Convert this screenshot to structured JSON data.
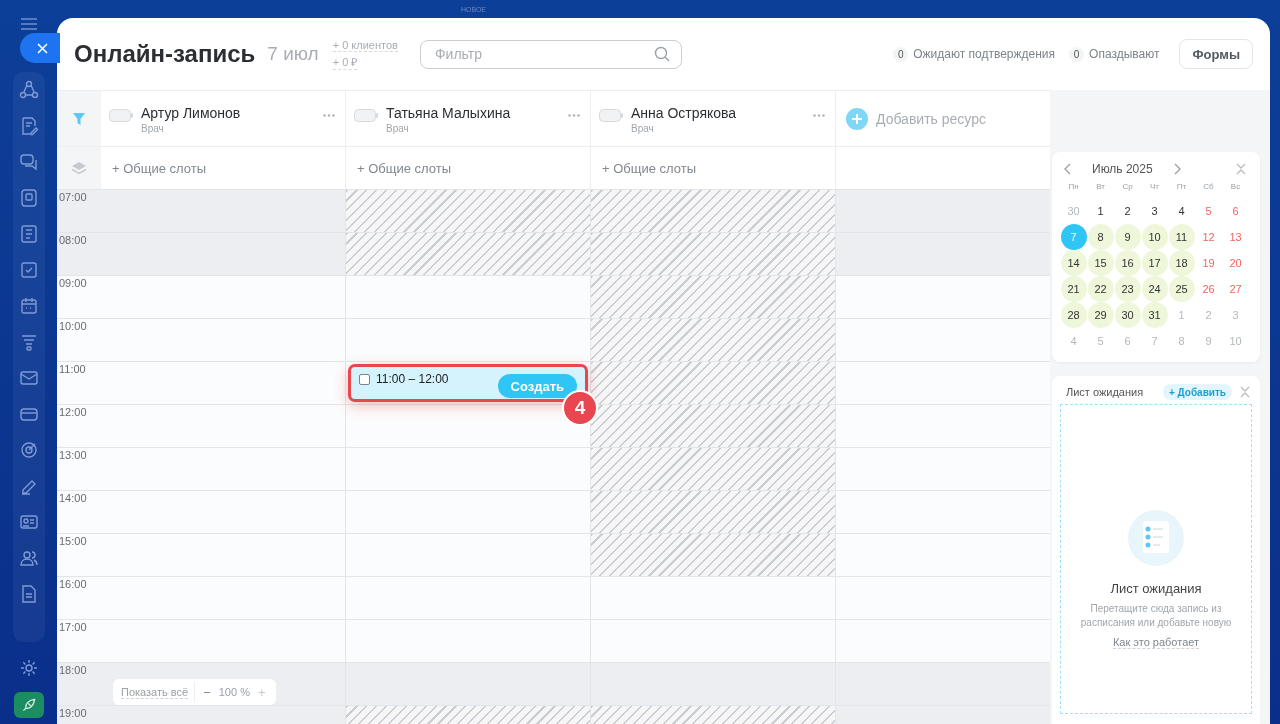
{
  "top_strip": {
    "label": "НОВОЕ"
  },
  "header": {
    "title": "Онлайн-запись",
    "date": "7 июл",
    "stats": [
      "+ 0 клиентов",
      "+ 0 ₽"
    ],
    "filter": {
      "placeholder": "Фильтр"
    },
    "counters": [
      {
        "count": "0",
        "label": "Ожидают подтверждения"
      },
      {
        "count": "0",
        "label": "Опаздывают"
      }
    ],
    "forms_button": "Формы"
  },
  "resources": [
    {
      "name": "Артур Лимонов",
      "role": "Врач",
      "slots": "+ Общие слоты",
      "cells": [
        {
          "blocked": false
        },
        {
          "blocked": false
        },
        {
          "blocked": false
        },
        {
          "blocked": false
        },
        {
          "blocked": false
        },
        {
          "blocked": false
        },
        {
          "blocked": false
        },
        {
          "blocked": false
        },
        {
          "blocked": false
        },
        {
          "blocked": false
        },
        {
          "blocked": false
        },
        {
          "blocked": false
        },
        {
          "blocked": false
        }
      ]
    },
    {
      "name": "Татьяна Малыхина",
      "role": "Врач",
      "slots": "+ Общие слоты",
      "cells": [
        {
          "blocked": true
        },
        {
          "blocked": true
        },
        {
          "blocked": false
        },
        {
          "blocked": false
        },
        {
          "blocked": false
        },
        {
          "blocked": false
        },
        {
          "blocked": false
        },
        {
          "blocked": false
        },
        {
          "blocked": false
        },
        {
          "blocked": false
        },
        {
          "blocked": false
        },
        {
          "blocked": false
        },
        {
          "blocked": true
        }
      ]
    },
    {
      "name": "Анна Острякова",
      "role": "Врач",
      "slots": "+ Общие слоты",
      "cells": [
        {
          "blocked": true
        },
        {
          "blocked": true
        },
        {
          "blocked": true
        },
        {
          "blocked": true
        },
        {
          "blocked": true
        },
        {
          "blocked": true
        },
        {
          "blocked": true
        },
        {
          "blocked": true
        },
        {
          "blocked": true
        },
        {
          "blocked": false
        },
        {
          "blocked": false
        },
        {
          "blocked": false
        },
        {
          "blocked": true
        }
      ]
    }
  ],
  "add_resource": "Добавить ресурс",
  "hours": [
    {
      "time": "07:00",
      "off_hours": true
    },
    {
      "time": "08:00",
      "off_hours": true
    },
    {
      "time": "09:00",
      "off_hours": false
    },
    {
      "time": "10:00",
      "off_hours": false
    },
    {
      "time": "11:00",
      "off_hours": false
    },
    {
      "time": "12:00",
      "off_hours": false
    },
    {
      "time": "13:00",
      "off_hours": false
    },
    {
      "time": "14:00",
      "off_hours": false
    },
    {
      "time": "15:00",
      "off_hours": false
    },
    {
      "time": "16:00",
      "off_hours": false
    },
    {
      "time": "17:00",
      "off_hours": false
    },
    {
      "time": "18:00",
      "off_hours": true
    },
    {
      "time": "19:00",
      "off_hours": true
    }
  ],
  "new_slot": {
    "time": "11:00 – 12:00",
    "checked": false,
    "button": "Создать",
    "callout": "4"
  },
  "zoom_bar": {
    "show_all": "Показать всё",
    "minus": "−",
    "value": "100 %",
    "plus": "+"
  },
  "calendar": {
    "title": "Июль 2025",
    "weekdays": [
      "Пн",
      "Вт",
      "Ср",
      "Чт",
      "Пт",
      "Сб",
      "Вс"
    ],
    "weeks": [
      [
        {
          "day": "30",
          "outside": true,
          "weekend": false,
          "available": false,
          "selected": false
        },
        {
          "day": "1",
          "outside": false,
          "weekend": false,
          "available": false,
          "selected": false
        },
        {
          "day": "2",
          "outside": false,
          "weekend": false,
          "available": false,
          "selected": false
        },
        {
          "day": "3",
          "outside": false,
          "weekend": false,
          "available": false,
          "selected": false
        },
        {
          "day": "4",
          "outside": false,
          "weekend": false,
          "available": false,
          "selected": false
        },
        {
          "day": "5",
          "outside": false,
          "weekend": true,
          "available": false,
          "selected": false
        },
        {
          "day": "6",
          "outside": false,
          "weekend": true,
          "available": false,
          "selected": false
        }
      ],
      [
        {
          "day": "7",
          "outside": false,
          "weekend": false,
          "available": true,
          "selected": true
        },
        {
          "day": "8",
          "outside": false,
          "weekend": false,
          "available": true,
          "selected": false
        },
        {
          "day": "9",
          "outside": false,
          "weekend": false,
          "available": true,
          "selected": false
        },
        {
          "day": "10",
          "outside": false,
          "weekend": false,
          "available": true,
          "selected": false
        },
        {
          "day": "11",
          "outside": false,
          "weekend": false,
          "available": true,
          "selected": false
        },
        {
          "day": "12",
          "outside": false,
          "weekend": true,
          "available": false,
          "selected": false
        },
        {
          "day": "13",
          "outside": false,
          "weekend": true,
          "available": false,
          "selected": false
        }
      ],
      [
        {
          "day": "14",
          "outside": false,
          "weekend": false,
          "available": true,
          "selected": false
        },
        {
          "day": "15",
          "outside": false,
          "weekend": false,
          "available": true,
          "selected": false
        },
        {
          "day": "16",
          "outside": false,
          "weekend": false,
          "available": true,
          "selected": false
        },
        {
          "day": "17",
          "outside": false,
          "weekend": false,
          "available": true,
          "selected": false
        },
        {
          "day": "18",
          "outside": false,
          "weekend": false,
          "available": true,
          "selected": false
        },
        {
          "day": "19",
          "outside": false,
          "weekend": true,
          "available": false,
          "selected": false
        },
        {
          "day": "20",
          "outside": false,
          "weekend": true,
          "available": false,
          "selected": false
        }
      ],
      [
        {
          "day": "21",
          "outside": false,
          "weekend": false,
          "available": true,
          "selected": false
        },
        {
          "day": "22",
          "outside": false,
          "weekend": false,
          "available": true,
          "selected": false
        },
        {
          "day": "23",
          "outside": false,
          "weekend": false,
          "available": true,
          "selected": false
        },
        {
          "day": "24",
          "outside": false,
          "weekend": false,
          "available": true,
          "selected": false
        },
        {
          "day": "25",
          "outside": false,
          "weekend": false,
          "available": true,
          "selected": false
        },
        {
          "day": "26",
          "outside": false,
          "weekend": true,
          "available": false,
          "selected": false
        },
        {
          "day": "27",
          "outside": false,
          "weekend": true,
          "available": false,
          "selected": false
        }
      ],
      [
        {
          "day": "28",
          "outside": false,
          "weekend": false,
          "available": true,
          "selected": false
        },
        {
          "day": "29",
          "outside": false,
          "weekend": false,
          "available": true,
          "selected": false
        },
        {
          "day": "30",
          "outside": false,
          "weekend": false,
          "available": true,
          "selected": false
        },
        {
          "day": "31",
          "outside": false,
          "weekend": false,
          "available": true,
          "selected": false
        },
        {
          "day": "1",
          "outside": true,
          "weekend": false,
          "available": false,
          "selected": false
        },
        {
          "day": "2",
          "outside": true,
          "weekend": false,
          "available": false,
          "selected": false
        },
        {
          "day": "3",
          "outside": true,
          "weekend": false,
          "available": false,
          "selected": false
        }
      ],
      [
        {
          "day": "4",
          "outside": true,
          "weekend": false,
          "available": false,
          "selected": false
        },
        {
          "day": "5",
          "outside": true,
          "weekend": false,
          "available": false,
          "selected": false
        },
        {
          "day": "6",
          "outside": true,
          "weekend": false,
          "available": false,
          "selected": false
        },
        {
          "day": "7",
          "outside": true,
          "weekend": false,
          "available": false,
          "selected": false
        },
        {
          "day": "8",
          "outside": true,
          "weekend": false,
          "available": false,
          "selected": false
        },
        {
          "day": "9",
          "outside": true,
          "weekend": false,
          "available": false,
          "selected": false
        },
        {
          "day": "10",
          "outside": true,
          "weekend": false,
          "available": false,
          "selected": false
        }
      ]
    ]
  },
  "waiting_list": {
    "title": "Лист ожидания",
    "add_button": "+ Добавить",
    "empty_title": "Лист ожидания",
    "empty_text": "Перетащите сюда запись из расписания или добавьте новую",
    "link": "Как это работает"
  }
}
